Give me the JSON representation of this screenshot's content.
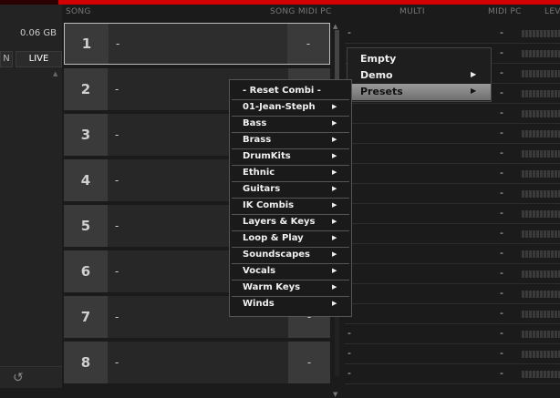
{
  "left_panel": {
    "memory": "0.06 GB",
    "btn_n": "N",
    "btn_live": "LIVE"
  },
  "headers": {
    "song": "SONG",
    "song_midi_pc": "SONG MIDI PC",
    "multi": "MULTI",
    "midi_pc": "MIDI PC",
    "level": "LEV"
  },
  "songs": [
    {
      "num": "1",
      "name": "-",
      "pc": "-"
    },
    {
      "num": "2",
      "name": "-",
      "pc": "-"
    },
    {
      "num": "3",
      "name": "-",
      "pc": "-"
    },
    {
      "num": "4",
      "name": "-",
      "pc": "-"
    },
    {
      "num": "5",
      "name": "-",
      "pc": "-"
    },
    {
      "num": "6",
      "name": "-",
      "pc": "-"
    },
    {
      "num": "7",
      "name": "-",
      "pc": "-"
    },
    {
      "num": "8",
      "name": "-",
      "pc": "-"
    }
  ],
  "multi_rows": [
    {
      "name": "-",
      "pc": "-"
    },
    {
      "name": "-",
      "pc": "-"
    },
    {
      "name": "-",
      "pc": "-"
    },
    {
      "name": "-",
      "pc": "-"
    },
    {
      "name": "-",
      "pc": "-"
    },
    {
      "name": "-",
      "pc": "-"
    },
    {
      "name": "-",
      "pc": "-"
    },
    {
      "name": "-",
      "pc": "-"
    },
    {
      "name": "-",
      "pc": "-"
    },
    {
      "name": "-",
      "pc": "-"
    },
    {
      "name": "-",
      "pc": "-"
    },
    {
      "name": "-",
      "pc": "-"
    },
    {
      "name": "-",
      "pc": "-"
    },
    {
      "name": "-",
      "pc": "-"
    },
    {
      "name": "-",
      "pc": "-"
    },
    {
      "name": "-",
      "pc": "-"
    },
    {
      "name": "-",
      "pc": "-"
    },
    {
      "name": "-",
      "pc": "-"
    }
  ],
  "submenu": [
    {
      "label": "Empty",
      "has_arrow": false
    },
    {
      "label": "Demo",
      "has_arrow": true
    },
    {
      "label": "Presets",
      "has_arrow": true,
      "highlighted": true
    }
  ],
  "dropdown": [
    {
      "label": "- Reset Combi -",
      "has_arrow": false
    },
    {
      "label": "01-Jean-Steph",
      "has_arrow": true
    },
    {
      "label": "Bass",
      "has_arrow": true
    },
    {
      "label": "Brass",
      "has_arrow": true
    },
    {
      "label": "DrumKits",
      "has_arrow": true
    },
    {
      "label": "Ethnic",
      "has_arrow": true
    },
    {
      "label": "Guitars",
      "has_arrow": true
    },
    {
      "label": "IK Combis",
      "has_arrow": true
    },
    {
      "label": "Layers & Keys",
      "has_arrow": true
    },
    {
      "label": "Loop & Play",
      "has_arrow": true
    },
    {
      "label": "Soundscapes",
      "has_arrow": true
    },
    {
      "label": "Vocals",
      "has_arrow": true
    },
    {
      "label": "Warm Keys",
      "has_arrow": true
    },
    {
      "label": "Winds",
      "has_arrow": true
    }
  ],
  "icons": {
    "arrow": "▶",
    "up": "▲",
    "down": "▼",
    "undo": "↺"
  },
  "colors": {
    "accent": "#d40000",
    "highlight": "#8a8a8a"
  }
}
